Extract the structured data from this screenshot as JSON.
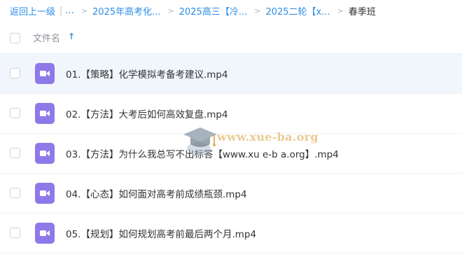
{
  "breadcrumb": {
    "back": "返回上一级",
    "ellipsis": "...",
    "crumbs": [
      "2025年高考化...",
      "2025高三【冷...",
      "2025二轮【x..."
    ],
    "current": "春季班",
    "separator_icon": "chevron-right-icon"
  },
  "header": {
    "column_title": "文件名",
    "sort_icon": "sort-ascending-icon"
  },
  "files": [
    {
      "name": "01.【策略】化学模拟考备考建议.mp4",
      "icon": "video-file-icon"
    },
    {
      "name": "02.【方法】大考后如何高效复盘.mp4",
      "icon": "video-file-icon"
    },
    {
      "name": "03.【方法】为什么我总写不出标答【www.xu e-b a.org】.mp4",
      "icon": "video-file-icon"
    },
    {
      "name": "04.【心态】如何面对高考前成绩瓶颈.mp4",
      "icon": "video-file-icon"
    },
    {
      "name": "05.【规划】如何规划高考前最后两个月.mp4",
      "icon": "video-file-icon"
    }
  ],
  "watermark": {
    "text": "www.xue-ba.org"
  },
  "colors": {
    "accent": "#2b8de6",
    "video_icon": "#8f79e8",
    "hover_row": "#f1f6fd"
  }
}
